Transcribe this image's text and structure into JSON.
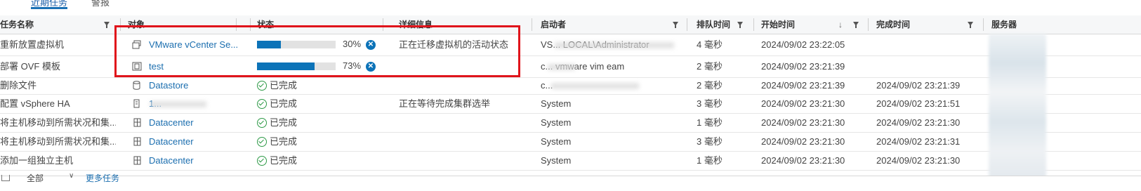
{
  "tabs": [
    {
      "label": "近期任务",
      "active": true
    },
    {
      "label": "警报",
      "active": false
    }
  ],
  "columns": {
    "task": "任务名称",
    "target": "对象",
    "status": "状态",
    "details": "详细信息",
    "initiator": "启动者",
    "queued": "排队时间",
    "start": "开始时间",
    "completion": "完成时间",
    "server": "服务器"
  },
  "sort_indicator": "↓",
  "rows": [
    {
      "task": "重新放置虚拟机",
      "target_icon": "vm-icon",
      "target": "VMware vCenter Se...",
      "status_type": "progress",
      "progress": 0.3,
      "progress_label": "30%",
      "details": "正在迁移虚拟机的活动状态",
      "initiator": "VS... LOCAL\\Administrator",
      "queued": "4 毫秒",
      "start": "2024/09/02 23:22:05",
      "completion": ""
    },
    {
      "task": "部署 OVF 模板",
      "target_icon": "vapp-icon",
      "target": "test",
      "status_type": "progress",
      "progress": 0.73,
      "progress_label": "73%",
      "details": "",
      "initiator": "c... vmware vim eam",
      "queued": "2 毫秒",
      "start": "2024/09/02 23:21:39",
      "completion": ""
    },
    {
      "task": "删除文件",
      "target_icon": "datastore-icon",
      "target": "Datastore",
      "status_type": "done",
      "status_label": "已完成",
      "details": "",
      "initiator": "c...",
      "queued": "2 毫秒",
      "start": "2024/09/02 23:21:39",
      "completion": "2024/09/02 23:21:39"
    },
    {
      "task": "配置 vSphere HA",
      "target_icon": "host-icon",
      "target": "1...",
      "status_type": "done",
      "status_label": "已完成",
      "details": "正在等待完成集群选举",
      "initiator": "System",
      "queued": "3 毫秒",
      "start": "2024/09/02 23:21:30",
      "completion": "2024/09/02 23:21:51"
    },
    {
      "task": "将主机移动到所需状况和集...",
      "target_icon": "datacenter-icon",
      "target": "Datacenter",
      "status_type": "done",
      "status_label": "已完成",
      "details": "",
      "initiator": "System",
      "queued": "1 毫秒",
      "start": "2024/09/02 23:21:30",
      "completion": "2024/09/02 23:21:30"
    },
    {
      "task": "将主机移动到所需状况和集...",
      "target_icon": "datacenter-icon",
      "target": "Datacenter",
      "status_type": "done",
      "status_label": "已完成",
      "details": "",
      "initiator": "System",
      "queued": "3 毫秒",
      "start": "2024/09/02 23:21:30",
      "completion": "2024/09/02 23:21:31"
    },
    {
      "task": "添加一组独立主机",
      "target_icon": "datacenter-icon",
      "target": "Datacenter",
      "status_type": "done",
      "status_label": "已完成",
      "details": "",
      "initiator": "System",
      "queued": "1 毫秒",
      "start": "2024/09/02 23:21:30",
      "completion": "2024/09/02 23:21:30"
    }
  ],
  "footer": {
    "filter_label": "全部",
    "more_tasks": "更多任务"
  },
  "colors": {
    "accent": "#0c73b8",
    "link": "#1b6eaf",
    "highlight": "#e0141b",
    "success": "#2e9a47"
  }
}
